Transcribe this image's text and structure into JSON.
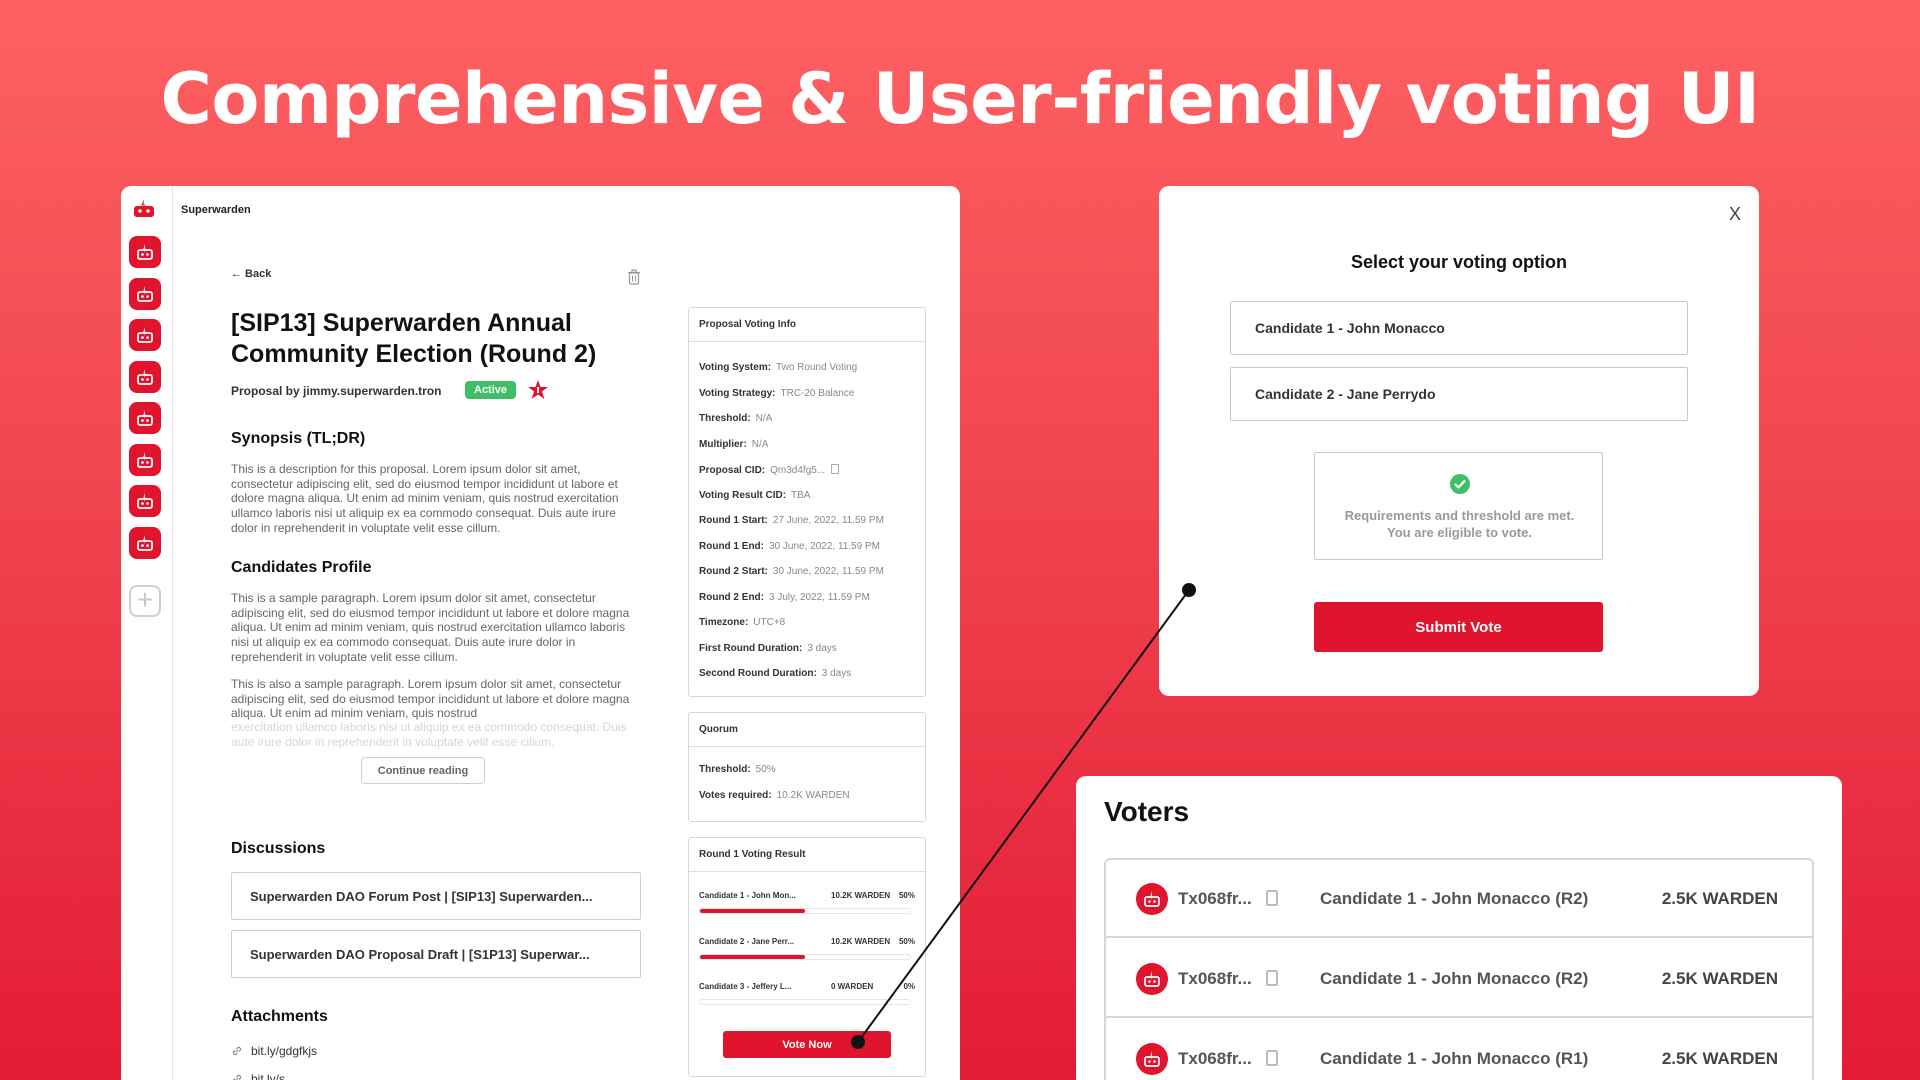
{
  "hero": {
    "title": "Comprehensive & User-friendly voting UI"
  },
  "app": {
    "name": "Superwarden"
  },
  "sidebar": {
    "add_icon": "plus-icon",
    "item_icon": "robot-icon"
  },
  "proposal": {
    "back_label": "← Back",
    "title": "[SIP13] Superwarden Annual Community Election (Round 2)",
    "proposer": "Proposal by jimmy.superwarden.tron",
    "status": "Active",
    "synopsis_heading": "Synopsis (TL;DR)",
    "synopsis_text": "This is a description for this proposal. Lorem ipsum dolor sit amet, consectetur adipiscing elit, sed do eiusmod tempor incididunt ut labore et dolore magna aliqua. Ut enim ad minim veniam, quis nostrud exercitation ullamco laboris nisi ut aliquip ex ea commodo consequat. Duis aute irure dolor in reprehenderit in voluptate velit esse cillum.",
    "candidates_heading": "Candidates Profile",
    "candidates_text_1": "This is a sample paragraph. Lorem ipsum dolor sit amet, consectetur adipiscing elit, sed do eiusmod tempor incididunt ut labore et dolore magna aliqua. Ut enim ad minim veniam, quis nostrud exercitation ullamco laboris nisi ut aliquip ex ea commodo consequat.  Duis aute irure dolor in reprehenderit in voluptate velit esse cillum.",
    "candidates_text_2": "This is also a sample paragraph. Lorem ipsum dolor sit amet, consectetur adipiscing elit, sed do eiusmod tempor incididunt ut labore et dolore magna aliqua. Ut enim ad minim veniam, quis nostrud",
    "candidates_text_2_fade": "exercitation ullamco laboris nisi ut aliquip ex ea commodo consequat. Duis aute irure dolor in reprehenderit in voluptate velit esse cillum.",
    "continue_label": "Continue reading",
    "discussions_heading": "Discussions",
    "discussions": [
      "Superwarden DAO Forum Post | [SIP13] Superwarden...",
      "Superwarden DAO Proposal Draft | [S1P13] Superwar..."
    ],
    "attachments_heading": "Attachments",
    "attachments": [
      "bit.ly/gdgfkjs",
      "bit.ly/s..."
    ]
  },
  "voting_info": {
    "heading": "Proposal Voting Info",
    "rows": [
      {
        "label": "Voting System:",
        "value": "Two Round Voting"
      },
      {
        "label": "Voting Strategy:",
        "value": "TRC-20 Balance"
      },
      {
        "label": "Threshold:",
        "value": "N/A"
      },
      {
        "label": "Multiplier:",
        "value": "N/A"
      },
      {
        "label": "Proposal CID:",
        "value": "Qm3d4fg5..."
      },
      {
        "label": "Voting Result CID:",
        "value": "TBA"
      },
      {
        "label": "Round 1 Start:",
        "value": "27 June, 2022, 11.59 PM"
      },
      {
        "label": "Round 1 End:",
        "value": "30 June, 2022, 11.59 PM"
      },
      {
        "label": "Round 2 Start:",
        "value": "30 June, 2022, 11.59 PM"
      },
      {
        "label": "Round 2 End:",
        "value": "3 July, 2022, 11.59 PM"
      },
      {
        "label": "Timezone:",
        "value": "UTC+8"
      },
      {
        "label": "First Round Duration:",
        "value": "3 days"
      },
      {
        "label": "Second Round Duration:",
        "value": "3 days"
      }
    ]
  },
  "quorum": {
    "heading": "Quorum",
    "threshold_label": "Threshold:",
    "threshold_value": "50%",
    "votes_label": "Votes required:",
    "votes_value": "10.2K WARDEN"
  },
  "round1_result": {
    "heading": "Round 1 Voting Result",
    "candidates": [
      {
        "name": "Candidate 1 - John Mon...",
        "amount": "10.2K WARDEN",
        "percent": "50%",
        "fraction": 0.5
      },
      {
        "name": "Candidate 2 - Jane Perr...",
        "amount": "10.2K WARDEN",
        "percent": "50%",
        "fraction": 0.5
      },
      {
        "name": "Candidate 3 - Jeffery L...",
        "amount": "0 WARDEN",
        "percent": "0%",
        "fraction": 0
      }
    ],
    "vote_now_label": "Vote Now"
  },
  "modal": {
    "close_label": "X",
    "title": "Select your voting option",
    "options": [
      "Candidate 1 -  John Monacco",
      "Candidate 2 -  Jane Perrydo"
    ],
    "eligibility_line1": "Requirements and threshold are met.",
    "eligibility_line2": "You are eligible to vote.",
    "submit_label": "Submit Vote"
  },
  "voters": {
    "title": "Voters",
    "rows": [
      {
        "tx": "Tx068fr...",
        "candidate": "Candidate 1 - John Monacco (R2)",
        "amount": "2.5K WARDEN"
      },
      {
        "tx": "Tx068fr...",
        "candidate": "Candidate 1 - John Monacco (R2)",
        "amount": "2.5K WARDEN"
      },
      {
        "tx": "Tx068fr...",
        "candidate": "Candidate 1 - John Monacco (R1)",
        "amount": "2.5K WARDEN"
      }
    ]
  },
  "colors": {
    "accent": "#e0142c",
    "active": "#3fbe67",
    "background_top": "#fe6162",
    "background_bottom": "#e31b34"
  }
}
